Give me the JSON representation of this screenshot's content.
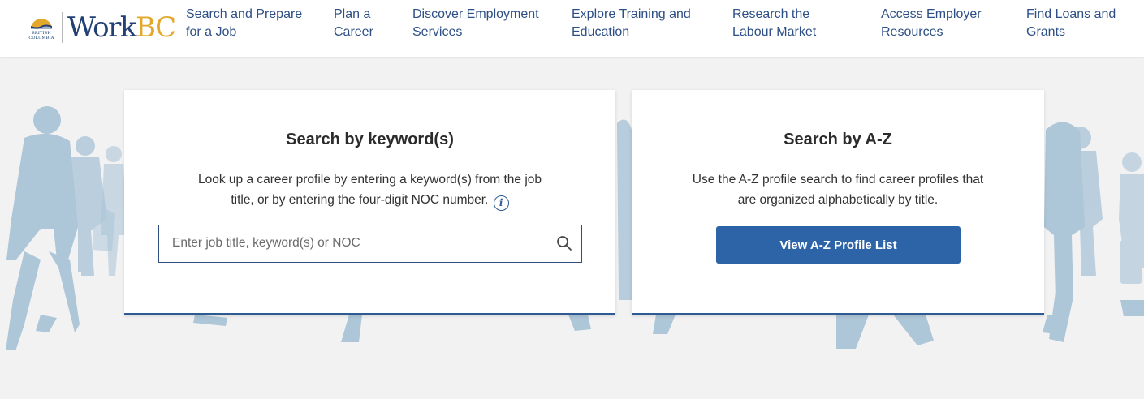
{
  "header": {
    "logo": {
      "emblem_text_line1": "BRITISH",
      "emblem_text_line2": "COLUMBIA",
      "word_main": "Work",
      "word_accent": "BC"
    },
    "nav": [
      {
        "line1": "Search and Prepare",
        "line2": "for a Job"
      },
      {
        "line1": "Plan a",
        "line2": "Career"
      },
      {
        "line1": "Discover Employment",
        "line2": "Services"
      },
      {
        "line1": "Explore Training and",
        "line2": "Education"
      },
      {
        "line1": "Research the",
        "line2": "Labour Market"
      },
      {
        "line1": "Access Employer",
        "line2": "Resources"
      },
      {
        "line1": "Find Loans and",
        "line2": "Grants"
      }
    ]
  },
  "keyword_card": {
    "title": "Search by keyword(s)",
    "desc_line1": "Look up a career profile by entering a keyword(s) from the job",
    "desc_line2": "title, or by entering the four-digit NOC number.",
    "info_icon": "info-circle-icon",
    "search": {
      "value": "",
      "placeholder": "Enter job title, keyword(s) or NOC",
      "icon": "search-icon"
    }
  },
  "az_card": {
    "title": "Search by A-Z",
    "desc_line1": "Use the A-Z profile search to find career profiles that",
    "desc_line2": "are organized alphabetically by title.",
    "button_label": "View A-Z Profile List"
  },
  "colors": {
    "nav_text": "#2d4f85",
    "logo_navy": "#234075",
    "logo_gold": "#e3a82b",
    "button_blue": "#2d64a8",
    "card_accent": "#2d5b92",
    "silhouette": "#a9c3d6",
    "background": "#f2f2f2"
  }
}
